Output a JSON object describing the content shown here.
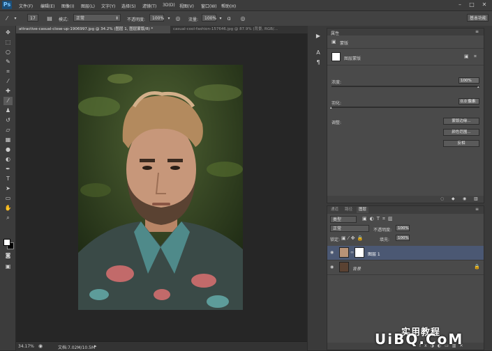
{
  "app": {
    "logo": "Ps"
  },
  "menu": [
    "文件(F)",
    "编辑(E)",
    "图像(I)",
    "图层(L)",
    "文字(Y)",
    "选择(S)",
    "滤镜(T)",
    "3D(D)",
    "视图(V)",
    "窗口(W)",
    "帮助(H)"
  ],
  "options": {
    "brush_size": "17",
    "mode_label": "模式:",
    "mode_value": "正常",
    "opacity_label": "不透明度:",
    "opacity_value": "100%",
    "flow_label": "流量:",
    "flow_value": "100%",
    "workspace": "基本功能"
  },
  "tabs": [
    {
      "label": "attractive-casual-close-up-1906997.jpg @ 34.2% (图层 1, 图层蒙版/8) *",
      "active": true
    },
    {
      "label": "casual-cool-fashion-157646.jpg @ 87.9% (背景, RGB/...",
      "active": false
    }
  ],
  "status": {
    "zoom": "34.17%",
    "doc": "文档:7.02M/10.5M"
  },
  "properties": {
    "panel_title": "属性",
    "mask_tab": "蒙版",
    "section_title": "图层蒙版",
    "density_label": "浓度:",
    "density_value": "100%",
    "feather_label": "羽化:",
    "feather_value": "0.0 像素",
    "adjust_label": "调整:",
    "btn_edge": "蒙版边缘...",
    "btn_color": "颜色范围...",
    "btn_invert": "反相"
  },
  "layers": {
    "tabs": [
      "通道",
      "路径",
      "图层"
    ],
    "filter": "类型",
    "blend": "正常",
    "opacity_label": "不透明度:",
    "opacity_value": "100%",
    "lock_label": "锁定:",
    "fill_label": "填充:",
    "fill_value": "100%",
    "items": [
      {
        "name": "图层 1",
        "selected": true
      },
      {
        "name": "背景",
        "selected": false
      }
    ]
  },
  "watermark": {
    "line1": "实用教程",
    "line2": "UiBQ.CoM"
  },
  "colors": {
    "accent": "#4b5873",
    "selected_row": "#4b5873",
    "panel": "#4a4a4a"
  }
}
